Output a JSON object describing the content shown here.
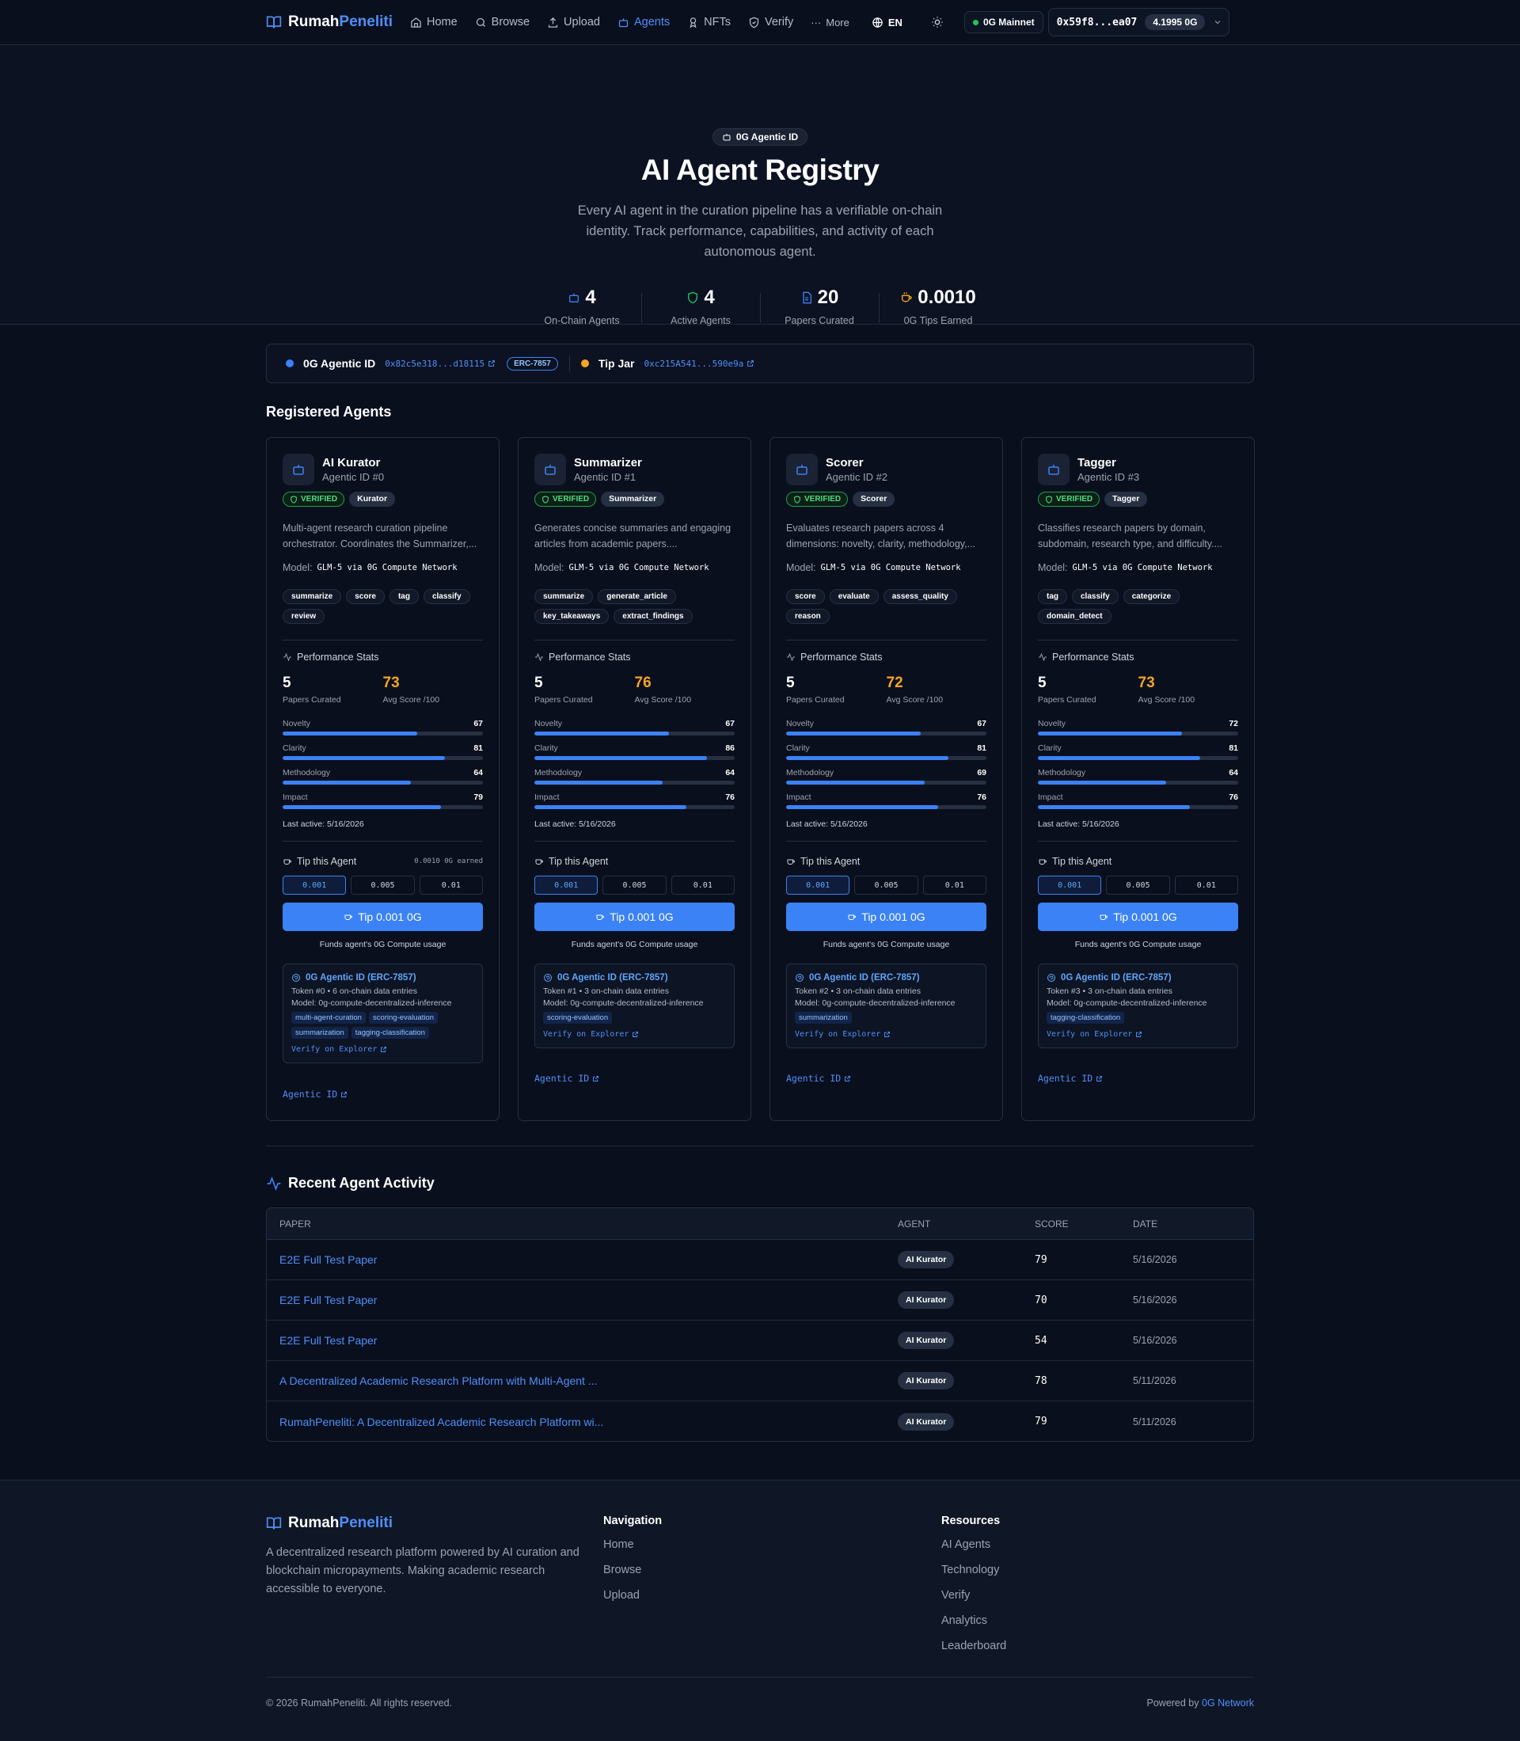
{
  "header": {
    "logo_a": "Rumah",
    "logo_b": "Peneliti",
    "nav": [
      "Home",
      "Browse",
      "Upload",
      "Agents",
      "NFTs",
      "Verify"
    ],
    "more": "More",
    "lang": "EN",
    "network": "0G Mainnet",
    "wallet_address": "0x59f8...ea07",
    "wallet_balance": "4.1995 0G"
  },
  "hero": {
    "badge": "0G Agentic ID",
    "title": "AI Agent Registry",
    "subtitle": "Every AI agent in the curation pipeline has a verifiable on-chain identity. Track performance, capabilities, and activity of each autonomous agent.",
    "stats": [
      {
        "value": "4",
        "label": "On-Chain Agents"
      },
      {
        "value": "4",
        "label": "Active Agents"
      },
      {
        "value": "20",
        "label": "Papers Curated"
      },
      {
        "value": "0.0010",
        "label": "0G Tips Earned"
      }
    ]
  },
  "idbar": {
    "id_label": "0G Agentic ID",
    "id_address": "0x82c5e318...d18115",
    "erc": "ERC-7857",
    "tip_label": "Tip Jar",
    "tip_address": "0xc215A541...590e9a"
  },
  "agents_title": "Registered Agents",
  "agents": [
    {
      "name": "AI Kurator",
      "agentic_id": "Agentic ID #0",
      "verified": "VERIFIED",
      "role": "Kurator",
      "description": "Multi-agent research curation pipeline orchestrator. Coordinates the Summarizer,...",
      "model_label": "Model:",
      "model": "GLM-5 via 0G Compute Network",
      "capabilities": [
        "summarize",
        "score",
        "tag",
        "classify",
        "review"
      ],
      "perf_title": "Performance Stats",
      "papers": "5",
      "papers_label": "Papers Curated",
      "avg": "73",
      "avg_label": "Avg Score /100",
      "metrics": [
        {
          "name": "Novelty",
          "value": 67
        },
        {
          "name": "Clarity",
          "value": 81
        },
        {
          "name": "Methodology",
          "value": 64
        },
        {
          "name": "Impact",
          "value": 79
        }
      ],
      "last_active": "Last active: 5/16/2026",
      "tip_title": "Tip this Agent",
      "earned": "0.0010 0G earned",
      "amounts": [
        "0.001",
        "0.005",
        "0.01"
      ],
      "tip_button": "Tip 0.001 0G",
      "funds": "Funds agent's 0G Compute usage",
      "erc_title": "0G Agentic ID (ERC-7857)",
      "token": "Token #0 • 6 on-chain data entries",
      "erc_model": "Model: 0g-compute-decentralized-inference",
      "tags": [
        "multi-agent-curation",
        "scoring-evaluation",
        "summarization",
        "tagging-classification"
      ],
      "verify": "Verify on Explorer",
      "link": "Agentic ID"
    },
    {
      "name": "Summarizer",
      "agentic_id": "Agentic ID #1",
      "verified": "VERIFIED",
      "role": "Summarizer",
      "description": "Generates concise summaries and engaging articles from academic papers....",
      "model_label": "Model:",
      "model": "GLM-5 via 0G Compute Network",
      "capabilities": [
        "summarize",
        "generate_article",
        "key_takeaways",
        "extract_findings"
      ],
      "perf_title": "Performance Stats",
      "papers": "5",
      "papers_label": "Papers Curated",
      "avg": "76",
      "avg_label": "Avg Score /100",
      "metrics": [
        {
          "name": "Novelty",
          "value": 67
        },
        {
          "name": "Clarity",
          "value": 86
        },
        {
          "name": "Methodology",
          "value": 64
        },
        {
          "name": "Impact",
          "value": 76
        }
      ],
      "last_active": "Last active: 5/16/2026",
      "tip_title": "Tip this Agent",
      "earned": "",
      "amounts": [
        "0.001",
        "0.005",
        "0.01"
      ],
      "tip_button": "Tip 0.001 0G",
      "funds": "Funds agent's 0G Compute usage",
      "erc_title": "0G Agentic ID (ERC-7857)",
      "token": "Token #1 • 3 on-chain data entries",
      "erc_model": "Model: 0g-compute-decentralized-inference",
      "tags": [
        "scoring-evaluation"
      ],
      "verify": "Verify on Explorer",
      "link": "Agentic ID"
    },
    {
      "name": "Scorer",
      "agentic_id": "Agentic ID #2",
      "verified": "VERIFIED",
      "role": "Scorer",
      "description": "Evaluates research papers across 4 dimensions: novelty, clarity, methodology,...",
      "model_label": "Model:",
      "model": "GLM-5 via 0G Compute Network",
      "capabilities": [
        "score",
        "evaluate",
        "assess_quality",
        "reason"
      ],
      "perf_title": "Performance Stats",
      "papers": "5",
      "papers_label": "Papers Curated",
      "avg": "72",
      "avg_label": "Avg Score /100",
      "metrics": [
        {
          "name": "Novelty",
          "value": 67
        },
        {
          "name": "Clarity",
          "value": 81
        },
        {
          "name": "Methodology",
          "value": 69
        },
        {
          "name": "Impact",
          "value": 76
        }
      ],
      "last_active": "Last active: 5/16/2026",
      "tip_title": "Tip this Agent",
      "earned": "",
      "amounts": [
        "0.001",
        "0.005",
        "0.01"
      ],
      "tip_button": "Tip 0.001 0G",
      "funds": "Funds agent's 0G Compute usage",
      "erc_title": "0G Agentic ID (ERC-7857)",
      "token": "Token #2 • 3 on-chain data entries",
      "erc_model": "Model: 0g-compute-decentralized-inference",
      "tags": [
        "summarization"
      ],
      "verify": "Verify on Explorer",
      "link": "Agentic ID"
    },
    {
      "name": "Tagger",
      "agentic_id": "Agentic ID #3",
      "verified": "VERIFIED",
      "role": "Tagger",
      "description": "Classifies research papers by domain, subdomain, research type, and difficulty....",
      "model_label": "Model:",
      "model": "GLM-5 via 0G Compute Network",
      "capabilities": [
        "tag",
        "classify",
        "categorize",
        "domain_detect"
      ],
      "perf_title": "Performance Stats",
      "papers": "5",
      "papers_label": "Papers Curated",
      "avg": "73",
      "avg_label": "Avg Score /100",
      "metrics": [
        {
          "name": "Novelty",
          "value": 72
        },
        {
          "name": "Clarity",
          "value": 81
        },
        {
          "name": "Methodology",
          "value": 64
        },
        {
          "name": "Impact",
          "value": 76
        }
      ],
      "last_active": "Last active: 5/16/2026",
      "tip_title": "Tip this Agent",
      "earned": "",
      "amounts": [
        "0.001",
        "0.005",
        "0.01"
      ],
      "tip_button": "Tip 0.001 0G",
      "funds": "Funds agent's 0G Compute usage",
      "erc_title": "0G Agentic ID (ERC-7857)",
      "token": "Token #3 • 3 on-chain data entries",
      "erc_model": "Model: 0g-compute-decentralized-inference",
      "tags": [
        "tagging-classification"
      ],
      "verify": "Verify on Explorer",
      "link": "Agentic ID"
    }
  ],
  "activity": {
    "title": "Recent Agent Activity",
    "columns": [
      "PAPER",
      "AGENT",
      "SCORE",
      "DATE"
    ],
    "rows": [
      {
        "paper": "E2E Full Test Paper",
        "agent": "AI Kurator",
        "score": "79",
        "date": "5/16/2026"
      },
      {
        "paper": "E2E Full Test Paper",
        "agent": "AI Kurator",
        "score": "70",
        "date": "5/16/2026"
      },
      {
        "paper": "E2E Full Test Paper",
        "agent": "AI Kurator",
        "score": "54",
        "date": "5/16/2026"
      },
      {
        "paper": "A Decentralized Academic Research Platform with Multi-Agent ...",
        "agent": "AI Kurator",
        "score": "78",
        "date": "5/11/2026"
      },
      {
        "paper": "RumahPeneliti: A Decentralized Academic Research Platform wi...",
        "agent": "AI Kurator",
        "score": "79",
        "date": "5/11/2026"
      }
    ]
  },
  "footer": {
    "description": "A decentralized research platform powered by AI curation and blockchain micropayments. Making academic research accessible to everyone.",
    "nav_title": "Navigation",
    "nav_links": [
      "Home",
      "Browse",
      "Upload"
    ],
    "res_title": "Resources",
    "res_links": [
      "AI Agents",
      "Technology",
      "Verify",
      "Analytics",
      "Leaderboard"
    ],
    "copyright": "© 2026 RumahPeneliti. All rights reserved.",
    "powered_prefix": "Powered by",
    "powered_link": "0G Network"
  },
  "colors": {
    "accent": "#3b82f6",
    "score": "#f5a524",
    "verified": "#4ade80",
    "bg": "#0a0f1e"
  }
}
